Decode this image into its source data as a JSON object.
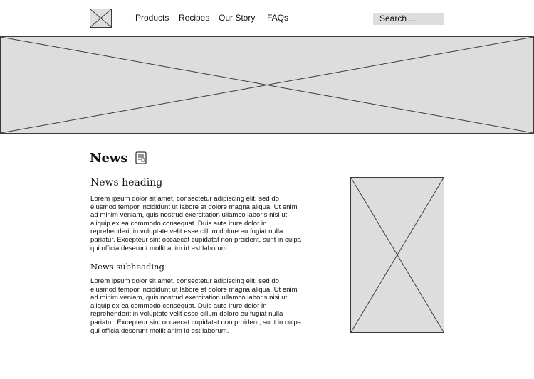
{
  "header": {
    "logo_icon": "image-placeholder-icon",
    "nav": [
      {
        "label": "Products"
      },
      {
        "label": "Recipes"
      },
      {
        "label": "Our Story"
      },
      {
        "label": "FAQs"
      }
    ],
    "search": {
      "placeholder": "Search ..."
    }
  },
  "hero": {
    "icon": "image-placeholder-icon"
  },
  "news": {
    "title": "News",
    "title_icon": "document-icon",
    "heading": "News heading",
    "paragraph1": "Lorem ipsum dolor sit amet, consectetur adipiscing elit, sed do eiusmod tempor incididunt ut labore et dolore magna aliqua. Ut enim ad minim veniam, quis nostrud exercitation ullamco laboris nisi ut aliquip ex ea commodo consequat. Duis aute irure dolor in reprehenderit in voluptate velit esse cillum dolore eu fugiat nulla pariatur. Excepteur sint occaecat cupidatat non proident, sunt in culpa qui officia deserunt mollit anim id est laborum.",
    "subheading": "News subheading",
    "paragraph2": "Lorem ipsum dolor sit amet, consectetur adipiscing elit, sed do eiusmod tempor incididunt ut labore et dolore magna aliqua. Ut enim ad minim veniam, quis nostrud exercitation ullamco laboris nisi ut aliquip ex ea commodo consequat. Duis aute irure dolor in reprehenderit in voluptate velit esse cillum dolore eu fugiat nulla pariatur. Excepteur sint occaecat cupidatat non proident, sunt in culpa qui officia deserunt mollit anim id est laborum.",
    "side_image_icon": "image-placeholder-icon"
  },
  "colors": {
    "placeholder_fill": "#dddddd",
    "placeholder_stroke": "#3a3a3a",
    "text": "#111111"
  }
}
